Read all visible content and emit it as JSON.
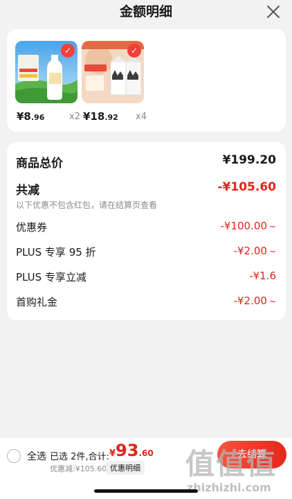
{
  "header": {
    "title": "金额明细"
  },
  "products": [
    {
      "price_int": "¥8",
      "price_dec": ".96",
      "qty": "x2"
    },
    {
      "price_int": "¥18",
      "price_dec": ".92",
      "qty": "x4"
    }
  ],
  "detail": {
    "total_label": "商品总价",
    "total_value": "¥199.20",
    "reduce_label": "共减",
    "reduce_value": "-¥105.60",
    "note": "以下优惠不包含红包，请在结算页查看",
    "items": [
      {
        "label": "优惠券",
        "value": "-¥100.00",
        "chevron": "~"
      },
      {
        "label": "PLUS 专享 95 折",
        "value": "-¥2.00",
        "chevron": "~"
      },
      {
        "label": "PLUS 专享立减",
        "value": "-¥1.6",
        "chevron": ""
      },
      {
        "label": "首购礼金",
        "value": "-¥2.00",
        "chevron": "~"
      }
    ]
  },
  "footer": {
    "select_all": "全选",
    "selected_count": "已选 2件,合计:",
    "total_yen": "¥",
    "total_int": "93",
    "total_dec": ".60",
    "discount_text": "优惠减:¥105.60",
    "detail_button": "优惠明细",
    "checkout_label": "去结算"
  },
  "watermark": {
    "big": "值值值",
    "small": "zhizhizhi.com"
  },
  "colors": {
    "accent_red": "#e2231a",
    "check_red": "#f2403a"
  },
  "icons": [
    "close-icon",
    "check-icon",
    "radio-icon"
  ]
}
